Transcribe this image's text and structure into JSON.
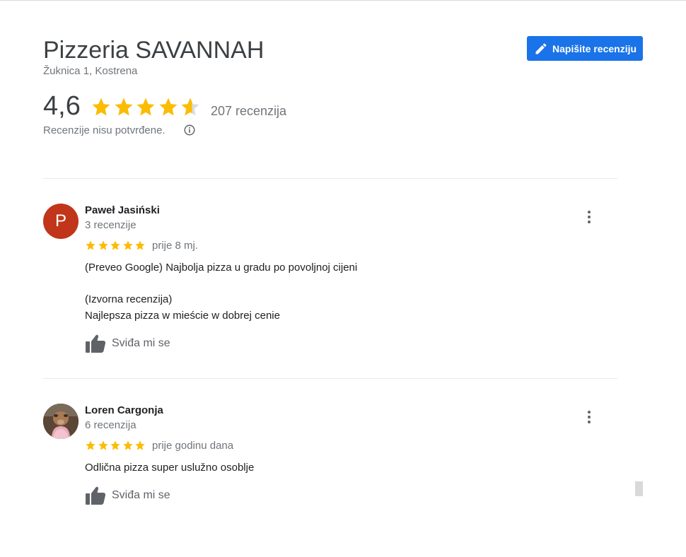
{
  "business": {
    "name": "Pizzeria SAVANNAH",
    "address": "Žuknica 1, Kostrena"
  },
  "write_review_button": {
    "label": "Napišite recenziju",
    "icon": "pencil-icon"
  },
  "rating": {
    "score": "4,6",
    "stars_value": 4.6,
    "count_text": "207 recenzija",
    "unverified_text": "Recenzije nisu potvrđene.",
    "info_icon": "info-icon"
  },
  "colors": {
    "star": "#fbbc04",
    "star_empty": "#dadce0",
    "accent": "#1a73e8",
    "avatar_p": "#c1351a"
  },
  "reviews": [
    {
      "avatar_letter": "P",
      "name": "Paweł Jasiński",
      "review_count": "3 recenzije",
      "stars": 5,
      "date": "prije 8 mj.",
      "text_translated": "(Preveo Google) Najbolja pizza u gradu po povoljnoj cijeni",
      "original_label": "(Izvorna recenzija)",
      "text_original": "Najlepsza pizza w mieście w dobrej cenie",
      "like_label": "Sviđa mi se"
    },
    {
      "avatar_letter": "",
      "name": "Loren Cargonja",
      "review_count": "6 recenzija",
      "stars": 5,
      "date": "prije godinu dana",
      "text": "Odlična pizza super uslužno osoblje",
      "like_label": "Sviđa mi se"
    }
  ]
}
